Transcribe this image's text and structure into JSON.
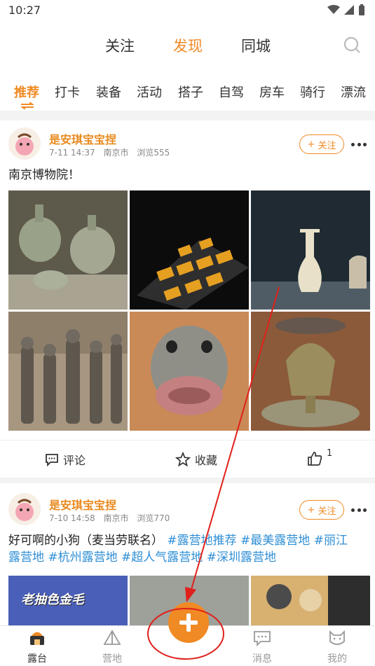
{
  "status": {
    "time": "10:27"
  },
  "topnav": {
    "tabs": [
      "关注",
      "发现",
      "同城"
    ],
    "active": "发现"
  },
  "categories": [
    "推荐",
    "打卡",
    "装备",
    "活动",
    "搭子",
    "自驾",
    "房车",
    "骑行",
    "漂流"
  ],
  "posts": [
    {
      "user": "是安琪宝宝捏",
      "date": "7-11 14:37",
      "city": "南京市",
      "views": "浏览555",
      "follow": "关注",
      "text": "南京博物院！",
      "actions": {
        "comment": "评论",
        "collect": "收藏",
        "likes": "1"
      }
    },
    {
      "user": "是安琪宝宝捏",
      "date": "7-10 14:58",
      "city": "南京市",
      "views": "浏览770",
      "follow": "关注",
      "text_plain": "好可啊的小狗（麦当劳联名）",
      "tags_line1": "#露营地推荐 #最美露营地 #丽江",
      "tags_line2": "露营地 #杭州露营地 #超人气露营地 #深圳露营地",
      "image_caption": "老抽色金毛"
    }
  ],
  "tabbar": {
    "items": [
      {
        "label": "露台",
        "icon": "tent-home-icon"
      },
      {
        "label": "营地",
        "icon": "camp-icon"
      },
      {
        "label": "消息",
        "icon": "message-icon"
      },
      {
        "label": "我的",
        "icon": "cat-profile-icon"
      }
    ],
    "active": "露台"
  },
  "colors": {
    "accent": "#f08a24",
    "tag": "#2f8fd5",
    "annotation": "#e0201b"
  }
}
